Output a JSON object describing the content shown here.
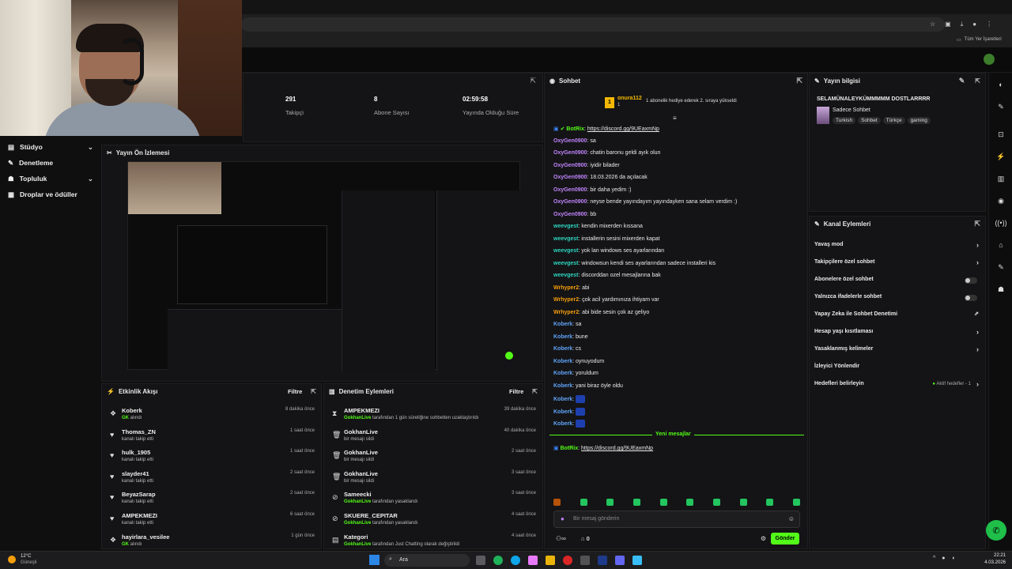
{
  "bookmarks_label": "Tüm Yer İşaretleri",
  "nav": [
    {
      "label": "Stüdyo",
      "icon": "studio-icon",
      "expand": true
    },
    {
      "label": "Denetleme",
      "icon": "wrench-icon",
      "expand": false
    },
    {
      "label": "Topluluk",
      "icon": "people-icon",
      "expand": true
    },
    {
      "label": "Droplar ve ödüller",
      "icon": "gift-icon",
      "expand": false
    }
  ],
  "stats": [
    {
      "value": "291",
      "label": "Takipçi"
    },
    {
      "value": "8",
      "label": "Abone Sayısı"
    },
    {
      "value": "02:59:58",
      "label": "Yayında Olduğu Süre"
    }
  ],
  "preview": {
    "title": "Yayın Ön İzlemesi"
  },
  "events": {
    "title": "Etkinlik Akışı",
    "filter": "Filtre",
    "rows": [
      {
        "name": "Koberk",
        "sub_green": "GK",
        "sub": "alındı",
        "time": "8 dakika önce",
        "icon": "gift-icon"
      },
      {
        "name": "Thomas_ZN",
        "sub_green": "",
        "sub": "kanalı takip etti",
        "time": "1 saat önce",
        "icon": "heart-icon"
      },
      {
        "name": "hulk_1905",
        "sub_green": "",
        "sub": "kanalı takip etti",
        "time": "1 saat önce",
        "icon": "heart-icon"
      },
      {
        "name": "slayder41",
        "sub_green": "",
        "sub": "kanalı takip etti",
        "time": "2 saat önce",
        "icon": "heart-icon"
      },
      {
        "name": "BeyazSarap",
        "sub_green": "",
        "sub": "kanalı takip etti",
        "time": "2 saat önce",
        "icon": "heart-icon"
      },
      {
        "name": "AMPEKMEZI",
        "sub_green": "",
        "sub": "kanalı takip etti",
        "time": "6 saat önce",
        "icon": "heart-icon"
      },
      {
        "name": "hayirlara_vesilee",
        "sub_green": "GK",
        "sub": "alındı",
        "time": "1 gün önce",
        "icon": "gift-icon"
      }
    ]
  },
  "moderation": {
    "title": "Denetim Eylemleri",
    "filter": "Filtre",
    "rows": [
      {
        "name": "AMPEKMEZI",
        "sub_green": "GokhanLive",
        "sub": "tarafından 1 gün süreliğine sohbetten uzaklaştırıldı",
        "time": "39 dakika önce",
        "icon": "hourglass-icon"
      },
      {
        "name": "GokhanLive",
        "sub_green": "",
        "sub": "bir mesajı sildi",
        "time": "40 dakika önce",
        "icon": "trash-icon"
      },
      {
        "name": "GokhanLive",
        "sub_green": "",
        "sub": "bir mesajı sildi",
        "time": "2 saat önce",
        "icon": "trash-icon"
      },
      {
        "name": "GokhanLive",
        "sub_green": "",
        "sub": "bir mesajı sildi",
        "time": "3 saat önce",
        "icon": "trash-icon"
      },
      {
        "name": "Sameecki",
        "sub_green": "GokhanLive",
        "sub": "tarafından yasaklandı",
        "time": "3 saat önce",
        "icon": "ban-icon"
      },
      {
        "name": "SKUERE_CEPITAR",
        "sub_green": "GokhanLive",
        "sub": "tarafından yasaklandı",
        "time": "4 saat önce",
        "icon": "ban-icon"
      },
      {
        "name": "Kategori",
        "sub_green": "GokhanLive",
        "sub": "tarafından Just Chatting olarak değiştirildi",
        "time": "4 saat önce",
        "icon": "category-icon"
      }
    ]
  },
  "chat": {
    "title": "Sohbet",
    "pinned_user": "onura112",
    "pinned_count": "1",
    "pinned_text": "1 abonelik hediye ederek 2. sıraya yükseldi",
    "messages": [
      {
        "user": "BotRix",
        "color": "#53fc18",
        "text": "https://discord.gg/9UEaxmNp",
        "link": true
      },
      {
        "user": "OxyGen0900",
        "color": "#c084fc",
        "text": "sa"
      },
      {
        "user": "OxyGen0900",
        "color": "#c084fc",
        "text": "chatin baronu geldi ayık olun"
      },
      {
        "user": "OxyGen0900",
        "color": "#c084fc",
        "text": "iyidir bilader"
      },
      {
        "user": "OxyGen0900",
        "color": "#c084fc",
        "text": "18.03.2026 da açılacak"
      },
      {
        "user": "OxyGen0900",
        "color": "#c084fc",
        "text": "bir daha yedim :)"
      },
      {
        "user": "OxyGen0900",
        "color": "#c084fc",
        "text": "neyse bende yayındayım yayındayken sana selam verdim :)"
      },
      {
        "user": "OxyGen0900",
        "color": "#c084fc",
        "text": "bb"
      },
      {
        "user": "weevgest",
        "color": "#2dd4bf",
        "text": "kendin mixerden kıssana"
      },
      {
        "user": "weevgest",
        "color": "#2dd4bf",
        "text": "installerin sesini mixerden kapat"
      },
      {
        "user": "weevgest",
        "color": "#2dd4bf",
        "text": "yok lan windows ses ayarlarından"
      },
      {
        "user": "weevgest",
        "color": "#2dd4bf",
        "text": "windowsun kendi ses ayarlarından sadece installeri kis"
      },
      {
        "user": "weevgest",
        "color": "#2dd4bf",
        "text": "discorddan ozel mesajlarına bak"
      },
      {
        "user": "Wrhyper2",
        "color": "#f59e0b",
        "text": "abi"
      },
      {
        "user": "Wrhyper2",
        "color": "#f59e0b",
        "text": "çok acil yardımınıza ihtiyam var"
      },
      {
        "user": "Wrhyper2",
        "color": "#f59e0b",
        "text": "abi bide sesin çok az geliyo"
      },
      {
        "user": "Koberk",
        "color": "#60a5fa",
        "text": "sa"
      },
      {
        "user": "Koberk",
        "color": "#60a5fa",
        "text": "bune"
      },
      {
        "user": "Koberk",
        "color": "#60a5fa",
        "text": "cs"
      },
      {
        "user": "Koberk",
        "color": "#60a5fa",
        "text": "oynuyodum"
      },
      {
        "user": "Koberk",
        "color": "#60a5fa",
        "text": "yoruldum"
      },
      {
        "user": "Koberk",
        "color": "#60a5fa",
        "text": "yani biraz öyle oldu"
      },
      {
        "user": "Koberk",
        "color": "#60a5fa",
        "text": "",
        "emote": true
      },
      {
        "user": "Koberk",
        "color": "#60a5fa",
        "text": "",
        "emote": true
      },
      {
        "user": "Koberk",
        "color": "#60a5fa",
        "text": "",
        "emote": true
      }
    ],
    "new_messages_label": "Yeni mesajlar",
    "last_message": {
      "user": "BotRix",
      "text": "https://discord.gg/9UEaxmNp"
    },
    "input_placeholder": "Bir mesaj gönderin",
    "footer_count": "0",
    "send_label": "Gönder"
  },
  "stream_info": {
    "title": "Yayın bilgisi",
    "stream_title": "SELAMÜNALEYKÜMMMMM DOSTLARRRR",
    "category": "Sadece Sohbet",
    "tags": [
      "Turkish",
      "Sohbet",
      "Türkçe",
      "gaming"
    ]
  },
  "channel_actions": {
    "title": "Kanal Eylemleri",
    "items": [
      {
        "label": "Yavaş mod",
        "control": "arrow"
      },
      {
        "label": "Takipçilere özel sohbet",
        "control": "arrow"
      },
      {
        "label": "Abonelere özel sohbet",
        "control": "toggle"
      },
      {
        "label": "Yalnızca ifadelerle sohbet",
        "control": "toggle"
      },
      {
        "label": "Yapay Zeka ile Sohbet Denetimi",
        "control": "external"
      },
      {
        "label": "Hesap yaşı kısıtlaması",
        "control": "arrow"
      },
      {
        "label": "Yasaklanmış kelimeler",
        "control": "arrow"
      },
      {
        "label": "İzleyici Yönlendir",
        "control": "none"
      },
      {
        "label": "Hedefleri belirleyin",
        "control": "arrow",
        "extra": "Aktif hedefler - 1"
      }
    ]
  },
  "taskbar": {
    "weather_temp": "12°C",
    "weather_desc": "Güneşli",
    "search": "Ara",
    "time": "22:21",
    "date": "4.03.2026"
  },
  "colors": {
    "accent": "#53fc18",
    "panel": "#141416",
    "bg": "#0f0f10"
  }
}
